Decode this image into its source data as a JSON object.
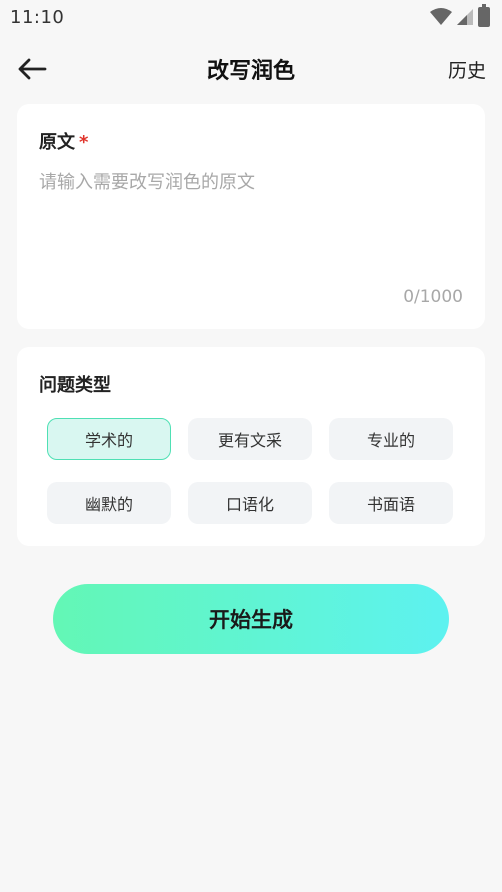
{
  "status_bar": {
    "time": "11:10"
  },
  "header": {
    "title": "改写润色",
    "history_label": "历史"
  },
  "source": {
    "label": "原文",
    "required_mark": "*",
    "value": "",
    "placeholder": "请输入需要改写润色的原文",
    "char_count": "0/1000"
  },
  "problem_types": {
    "label": "问题类型",
    "options": [
      {
        "label": "学术的",
        "selected": true
      },
      {
        "label": "更有文采",
        "selected": false
      },
      {
        "label": "专业的",
        "selected": false
      },
      {
        "label": "幽默的",
        "selected": false
      },
      {
        "label": "口语化",
        "selected": false
      },
      {
        "label": "书面语",
        "selected": false
      }
    ]
  },
  "start_button": {
    "label": "开始生成"
  },
  "colors": {
    "accent_start": "#63f7b5",
    "accent_end": "#5df2f0",
    "selected_tag_bg": "#d9f7f1",
    "selected_tag_border": "#4fe0b4",
    "required": "#e0342b"
  }
}
